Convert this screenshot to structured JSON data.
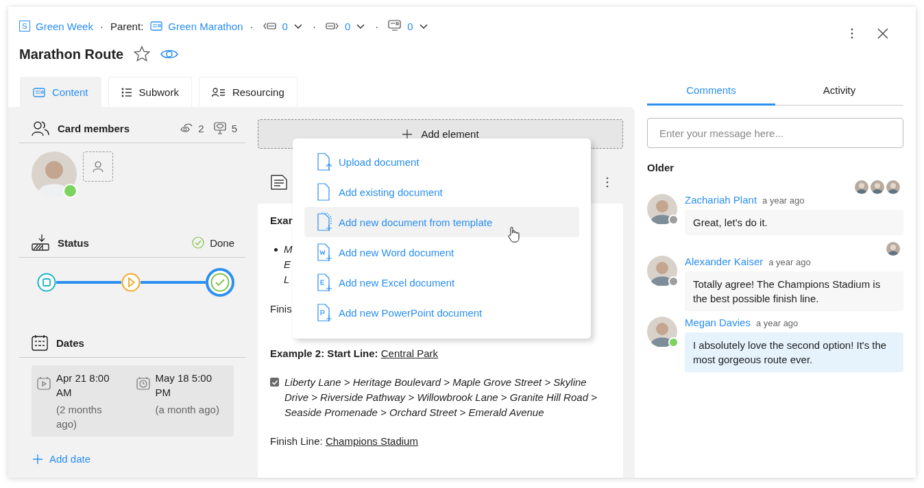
{
  "breadcrumb": {
    "space_badge": "S",
    "space": "Green Week",
    "parent_label": "Parent:",
    "parent": "Green Marathon",
    "separator": "·",
    "counters": [
      {
        "kind": "incoming",
        "value": "0"
      },
      {
        "kind": "outgoing",
        "value": "0"
      },
      {
        "kind": "linked",
        "value": "0"
      }
    ]
  },
  "title": "Marathon Route",
  "starred": false,
  "watching": true,
  "tabs": [
    {
      "label": "Content",
      "kind": "content",
      "selected": true
    },
    {
      "label": "Subwork",
      "kind": "list",
      "selected": false
    },
    {
      "label": "Resourcing",
      "kind": "people",
      "selected": false
    }
  ],
  "members": {
    "title": "Card members",
    "watchers": "2",
    "viewers": "5",
    "people": [
      {
        "online": true
      }
    ]
  },
  "status": {
    "title": "Status",
    "value": "Done",
    "steps": [
      {
        "kind": "stop",
        "selected": false
      },
      {
        "kind": "play",
        "selected": false
      },
      {
        "kind": "done",
        "selected": true
      }
    ]
  },
  "dates": {
    "title": "Dates",
    "items": [
      {
        "kind": "start",
        "date": "Apr 21 8:00 AM",
        "relative": "(2 months ago)"
      },
      {
        "kind": "end",
        "date": "May 18 5:00 PM",
        "relative": "(a month ago)"
      }
    ],
    "add": "Add date"
  },
  "add_element": "Add element",
  "document": {
    "heading_fragment": "Exar",
    "bullet_fragments": [
      "M",
      "E",
      "L"
    ],
    "finish_fragment": "Finis",
    "example2_label": "Example 2: Start Line:",
    "example2_link": "Central Park",
    "route_checked": true,
    "route": "Liberty Lane > Heritage Boulevard > Maple Grove Street > Skyline Drive > Riverside Pathway > Willowbrook Lane > Granite Hill Road > Seaside Promenade > Orchard Street > Emerald Avenue",
    "finish_label": "Finish Line:",
    "finish_link": "Champions Stadium"
  },
  "menu": [
    {
      "label": "Upload document",
      "kind": "upload",
      "selected": false
    },
    {
      "label": "Add existing document",
      "kind": "existing",
      "selected": false
    },
    {
      "label": "Add new document from template",
      "kind": "template",
      "selected": true
    },
    {
      "label": "Add new Word document",
      "kind": "W",
      "selected": false
    },
    {
      "label": "Add new Excel document",
      "kind": "E",
      "selected": false
    },
    {
      "label": "Add new PowerPoint document",
      "kind": "P",
      "selected": false
    }
  ],
  "side_tabs": [
    {
      "label": "Comments",
      "selected": true
    },
    {
      "label": "Activity",
      "selected": false
    }
  ],
  "comment_placeholder": "Enter your message here...",
  "older": "Older",
  "comments": [
    {
      "author": "Zachariah Plant",
      "time": "a year ago",
      "text": "Great, let's do it.",
      "online": false,
      "own": false,
      "readers": [
        {
          "kind": "avatar"
        },
        {
          "kind": "avatar"
        },
        {
          "kind": "avatar"
        }
      ]
    },
    {
      "author": "Alexander Kaiser",
      "time": "a year ago",
      "text": "Totally agree! The Champions Stadium is the best possible finish line.",
      "online": false,
      "own": false,
      "readers": [
        {
          "kind": "avatar"
        }
      ]
    },
    {
      "author": "Megan Davies",
      "time": "a year ago",
      "text": "I absolutely love the second option! It's the most gorgeous route ever.",
      "online": true,
      "own": true
    }
  ]
}
